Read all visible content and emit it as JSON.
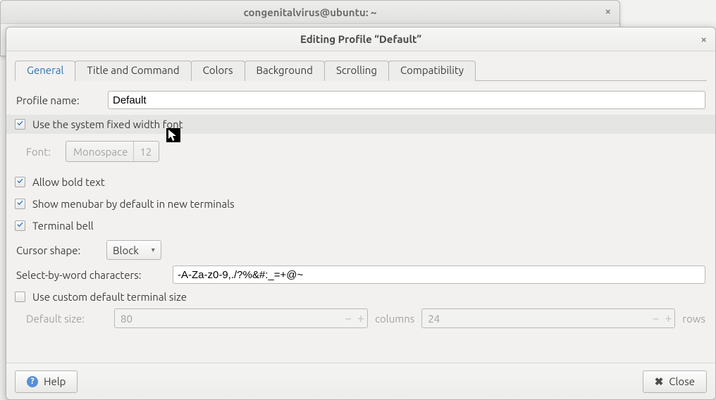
{
  "parent_window": {
    "title": "congenitalvirus@ubuntu: ~"
  },
  "dialog": {
    "title": "Editing Profile “Default”"
  },
  "tabs": {
    "general": "General",
    "title_command": "Title and Command",
    "colors": "Colors",
    "background": "Background",
    "scrolling": "Scrolling",
    "compatibility": "Compatibility"
  },
  "profile_name": {
    "label": "Profile name:",
    "value": "Default"
  },
  "system_font": {
    "label": "Use the system fixed width font",
    "checked": true
  },
  "font": {
    "label": "Font:",
    "family": "Monospace",
    "size": "12"
  },
  "allow_bold": {
    "label": "Allow bold text",
    "checked": true
  },
  "show_menubar": {
    "label": "Show menubar by default in new terminals",
    "checked": true
  },
  "terminal_bell": {
    "label": "Terminal bell",
    "checked": true
  },
  "cursor_shape": {
    "label": "Cursor shape:",
    "value": "Block"
  },
  "select_by_word": {
    "label": "Select-by-word characters:",
    "value": "-A-Za-z0-9,./?%&#:_=+@~"
  },
  "custom_size": {
    "label": "Use custom default terminal size",
    "checked": false
  },
  "default_size": {
    "label": "Default size:",
    "cols": "80",
    "columns_label": "columns",
    "rows": "24",
    "rows_label": "rows"
  },
  "footer": {
    "help": "Help",
    "close": "Close"
  }
}
